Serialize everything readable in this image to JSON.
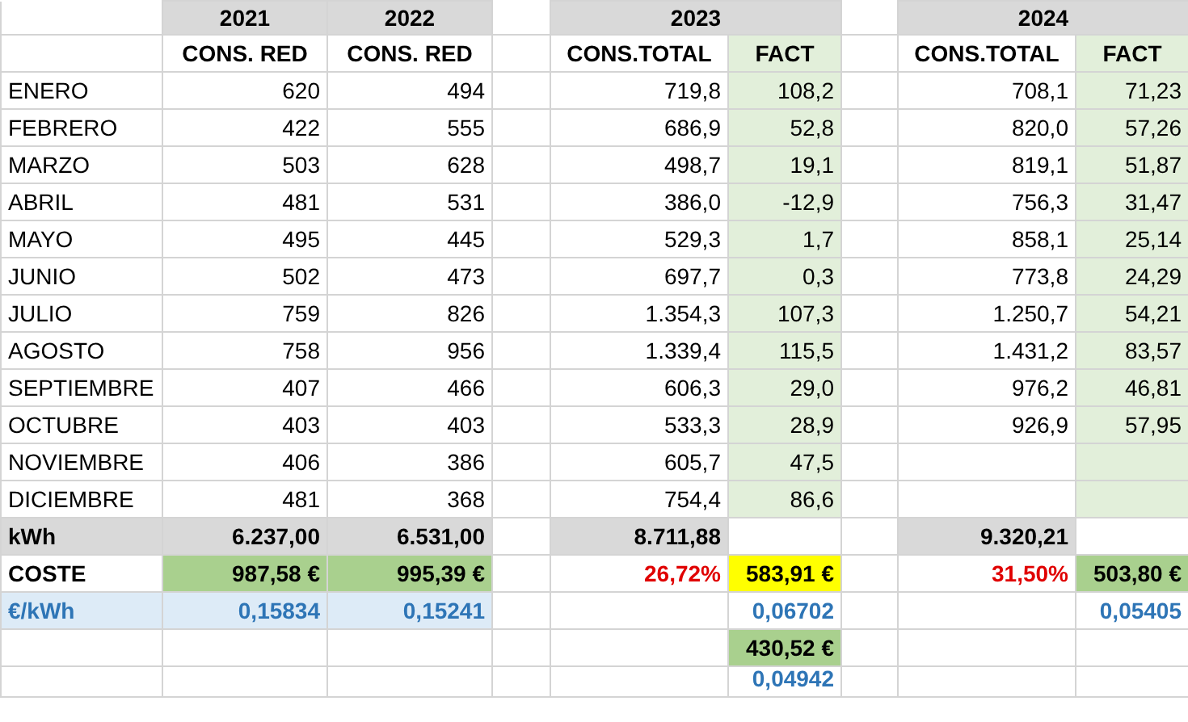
{
  "years": [
    "2021",
    "2022",
    "2023",
    "2024"
  ],
  "column_headers": {
    "y2021": "CONS. RED",
    "y2022": "CONS. RED",
    "t2023": "CONS.TOTAL",
    "f2023": "FACT",
    "t2024": "CONS.TOTAL",
    "f2024": "FACT"
  },
  "rows": [
    {
      "kind": "month",
      "label": "ENERO",
      "y2021": "620",
      "y2022": "494",
      "t2023": "719,8",
      "f2023": "108,2",
      "t2024": "708,1",
      "f2024": "71,23"
    },
    {
      "kind": "month",
      "label": "FEBRERO",
      "y2021": "422",
      "y2022": "555",
      "t2023": "686,9",
      "f2023": "52,8",
      "t2024": "820,0",
      "f2024": "57,26"
    },
    {
      "kind": "month",
      "label": "MARZO",
      "y2021": "503",
      "y2022": "628",
      "t2023": "498,7",
      "f2023": "19,1",
      "t2024": "819,1",
      "f2024": "51,87"
    },
    {
      "kind": "month",
      "label": "ABRIL",
      "y2021": "481",
      "y2022": "531",
      "t2023": "386,0",
      "f2023": "-12,9",
      "t2024": "756,3",
      "f2024": "31,47"
    },
    {
      "kind": "month",
      "label": "MAYO",
      "y2021": "495",
      "y2022": "445",
      "t2023": "529,3",
      "f2023": "1,7",
      "t2024": "858,1",
      "f2024": "25,14"
    },
    {
      "kind": "month",
      "label": "JUNIO",
      "y2021": "502",
      "y2022": "473",
      "t2023": "697,7",
      "f2023": "0,3",
      "t2024": "773,8",
      "f2024": "24,29"
    },
    {
      "kind": "month",
      "label": "JULIO",
      "y2021": "759",
      "y2022": "826",
      "t2023": "1.354,3",
      "f2023": "107,3",
      "t2024": "1.250,7",
      "f2024": "54,21"
    },
    {
      "kind": "month",
      "label": "AGOSTO",
      "y2021": "758",
      "y2022": "956",
      "t2023": "1.339,4",
      "f2023": "115,5",
      "t2024": "1.431,2",
      "f2024": "83,57"
    },
    {
      "kind": "month",
      "label": "SEPTIEMBRE",
      "y2021": "407",
      "y2022": "466",
      "t2023": "606,3",
      "f2023": "29,0",
      "t2024": "976,2",
      "f2024": "46,81"
    },
    {
      "kind": "month",
      "label": "OCTUBRE",
      "y2021": "403",
      "y2022": "403",
      "t2023": "533,3",
      "f2023": "28,9",
      "t2024": "926,9",
      "f2024": "57,95"
    },
    {
      "kind": "month",
      "label": "NOVIEMBRE",
      "y2021": "406",
      "y2022": "386",
      "t2023": "605,7",
      "f2023": "47,5"
    },
    {
      "kind": "month",
      "label": "DICIEMBRE",
      "y2021": "481",
      "y2022": "368",
      "t2023": "754,4",
      "f2023": "86,6"
    },
    {
      "kind": "kwh",
      "label": "kWh",
      "y2021": "6.237,00",
      "y2022": "6.531,00",
      "t2023": "8.711,88",
      "t2024": "9.320,21"
    },
    {
      "kind": "cost",
      "label": "COSTE",
      "y2021": "987,58 €",
      "y2022": "995,39 €",
      "t2023": "26,72%",
      "f2023": "583,91 €",
      "t2024": "31,50%",
      "f2024": "503,80 €"
    },
    {
      "kind": "rate",
      "label": "€/kWh",
      "y2021": "0,15834",
      "y2022": "0,15241",
      "f2023": "0,06702",
      "f2024": "0,05405"
    },
    {
      "kind": "subtotal",
      "f2023": "430,52 €"
    },
    {
      "kind": "subrate",
      "f2023": "0,04942"
    }
  ]
}
